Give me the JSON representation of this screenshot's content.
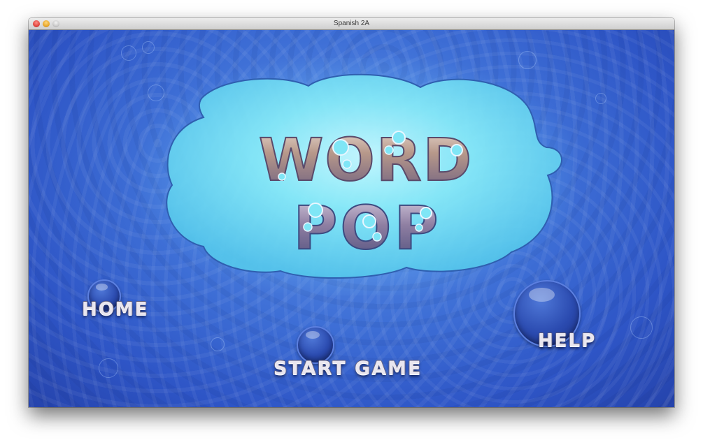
{
  "window": {
    "title": "Spanish 2A"
  },
  "game": {
    "logo_line1": "WORD",
    "logo_line2": "POP",
    "menu": {
      "home": "HOME",
      "start": "START GAME",
      "help": "HELP"
    }
  },
  "colors": {
    "water": "#3e6fd6",
    "cloud": "#7fe6f6",
    "logo_fill": "#b89a8e",
    "logo_dark": "#7c6a8c"
  }
}
